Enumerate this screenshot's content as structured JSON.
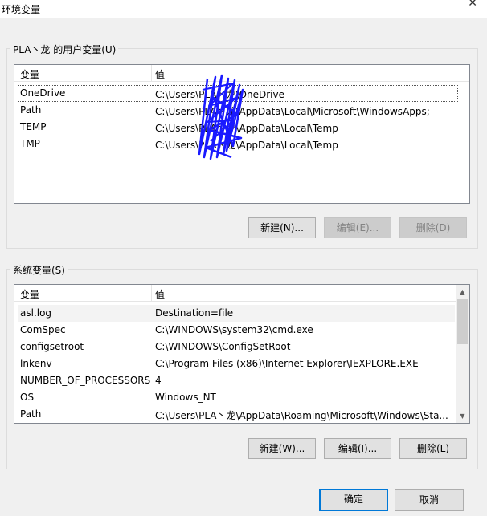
{
  "window": {
    "title": "环境变量",
    "close_glyph": "✕"
  },
  "user_vars": {
    "legend": "PLA丶龙 的用户变量(U)",
    "columns": [
      "变量",
      "值"
    ],
    "rows": [
      {
        "name": "OneDrive",
        "value": "C:\\Users\\PLA丶龙\\OneDrive"
      },
      {
        "name": "Path",
        "value": "C:\\Users\\PLA丶龙\\AppData\\Local\\Microsoft\\WindowsApps;"
      },
      {
        "name": "TEMP",
        "value": "C:\\Users\\PLA丶龙\\AppData\\Local\\Temp"
      },
      {
        "name": "TMP",
        "value": "C:\\Users\\PLA丶龙\\AppData\\Local\\Temp"
      }
    ],
    "buttons": {
      "new": "新建(N)...",
      "edit": "编辑(E)...",
      "delete": "删除(D)"
    }
  },
  "system_vars": {
    "legend": "系统变量(S)",
    "columns": [
      "变量",
      "值"
    ],
    "rows": [
      {
        "name": "asl.log",
        "value": "Destination=file"
      },
      {
        "name": "ComSpec",
        "value": "C:\\WINDOWS\\system32\\cmd.exe"
      },
      {
        "name": "configsetroot",
        "value": "C:\\WINDOWS\\ConfigSetRoot"
      },
      {
        "name": "lnkenv",
        "value": "C:\\Program Files (x86)\\Internet Explorer\\IEXPLORE.EXE"
      },
      {
        "name": "NUMBER_OF_PROCESSORS",
        "value": "4"
      },
      {
        "name": "OS",
        "value": "Windows_NT"
      },
      {
        "name": "Path",
        "value": "C:\\Users\\PLA丶龙\\AppData\\Roaming\\Microsoft\\Windows\\Sta..."
      }
    ],
    "buttons": {
      "new": "新建(W)...",
      "edit": "编辑(I)...",
      "delete": "删除(L)"
    }
  },
  "footer": {
    "ok": "确定",
    "cancel": "取消"
  },
  "colors": {
    "accent": "#0078d7",
    "scribble": "#1a1aff"
  }
}
